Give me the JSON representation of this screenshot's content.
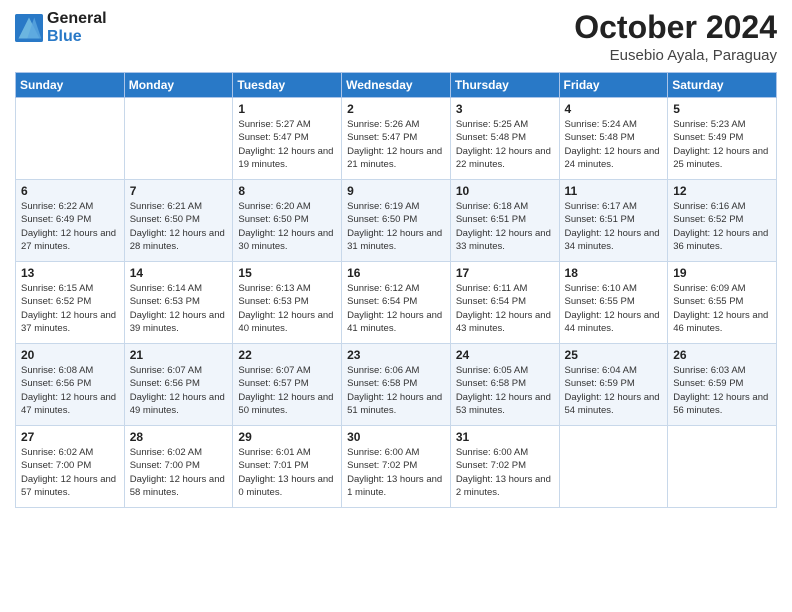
{
  "logo": {
    "line1": "General",
    "line2": "Blue"
  },
  "title": "October 2024",
  "location": "Eusebio Ayala, Paraguay",
  "days_of_week": [
    "Sunday",
    "Monday",
    "Tuesday",
    "Wednesday",
    "Thursday",
    "Friday",
    "Saturday"
  ],
  "weeks": [
    [
      {
        "day": "",
        "info": ""
      },
      {
        "day": "",
        "info": ""
      },
      {
        "day": "1",
        "info": "Sunrise: 5:27 AM\nSunset: 5:47 PM\nDaylight: 12 hours and 19 minutes."
      },
      {
        "day": "2",
        "info": "Sunrise: 5:26 AM\nSunset: 5:47 PM\nDaylight: 12 hours and 21 minutes."
      },
      {
        "day": "3",
        "info": "Sunrise: 5:25 AM\nSunset: 5:48 PM\nDaylight: 12 hours and 22 minutes."
      },
      {
        "day": "4",
        "info": "Sunrise: 5:24 AM\nSunset: 5:48 PM\nDaylight: 12 hours and 24 minutes."
      },
      {
        "day": "5",
        "info": "Sunrise: 5:23 AM\nSunset: 5:49 PM\nDaylight: 12 hours and 25 minutes."
      }
    ],
    [
      {
        "day": "6",
        "info": "Sunrise: 6:22 AM\nSunset: 6:49 PM\nDaylight: 12 hours and 27 minutes."
      },
      {
        "day": "7",
        "info": "Sunrise: 6:21 AM\nSunset: 6:50 PM\nDaylight: 12 hours and 28 minutes."
      },
      {
        "day": "8",
        "info": "Sunrise: 6:20 AM\nSunset: 6:50 PM\nDaylight: 12 hours and 30 minutes."
      },
      {
        "day": "9",
        "info": "Sunrise: 6:19 AM\nSunset: 6:50 PM\nDaylight: 12 hours and 31 minutes."
      },
      {
        "day": "10",
        "info": "Sunrise: 6:18 AM\nSunset: 6:51 PM\nDaylight: 12 hours and 33 minutes."
      },
      {
        "day": "11",
        "info": "Sunrise: 6:17 AM\nSunset: 6:51 PM\nDaylight: 12 hours and 34 minutes."
      },
      {
        "day": "12",
        "info": "Sunrise: 6:16 AM\nSunset: 6:52 PM\nDaylight: 12 hours and 36 minutes."
      }
    ],
    [
      {
        "day": "13",
        "info": "Sunrise: 6:15 AM\nSunset: 6:52 PM\nDaylight: 12 hours and 37 minutes."
      },
      {
        "day": "14",
        "info": "Sunrise: 6:14 AM\nSunset: 6:53 PM\nDaylight: 12 hours and 39 minutes."
      },
      {
        "day": "15",
        "info": "Sunrise: 6:13 AM\nSunset: 6:53 PM\nDaylight: 12 hours and 40 minutes."
      },
      {
        "day": "16",
        "info": "Sunrise: 6:12 AM\nSunset: 6:54 PM\nDaylight: 12 hours and 41 minutes."
      },
      {
        "day": "17",
        "info": "Sunrise: 6:11 AM\nSunset: 6:54 PM\nDaylight: 12 hours and 43 minutes."
      },
      {
        "day": "18",
        "info": "Sunrise: 6:10 AM\nSunset: 6:55 PM\nDaylight: 12 hours and 44 minutes."
      },
      {
        "day": "19",
        "info": "Sunrise: 6:09 AM\nSunset: 6:55 PM\nDaylight: 12 hours and 46 minutes."
      }
    ],
    [
      {
        "day": "20",
        "info": "Sunrise: 6:08 AM\nSunset: 6:56 PM\nDaylight: 12 hours and 47 minutes."
      },
      {
        "day": "21",
        "info": "Sunrise: 6:07 AM\nSunset: 6:56 PM\nDaylight: 12 hours and 49 minutes."
      },
      {
        "day": "22",
        "info": "Sunrise: 6:07 AM\nSunset: 6:57 PM\nDaylight: 12 hours and 50 minutes."
      },
      {
        "day": "23",
        "info": "Sunrise: 6:06 AM\nSunset: 6:58 PM\nDaylight: 12 hours and 51 minutes."
      },
      {
        "day": "24",
        "info": "Sunrise: 6:05 AM\nSunset: 6:58 PM\nDaylight: 12 hours and 53 minutes."
      },
      {
        "day": "25",
        "info": "Sunrise: 6:04 AM\nSunset: 6:59 PM\nDaylight: 12 hours and 54 minutes."
      },
      {
        "day": "26",
        "info": "Sunrise: 6:03 AM\nSunset: 6:59 PM\nDaylight: 12 hours and 56 minutes."
      }
    ],
    [
      {
        "day": "27",
        "info": "Sunrise: 6:02 AM\nSunset: 7:00 PM\nDaylight: 12 hours and 57 minutes."
      },
      {
        "day": "28",
        "info": "Sunrise: 6:02 AM\nSunset: 7:00 PM\nDaylight: 12 hours and 58 minutes."
      },
      {
        "day": "29",
        "info": "Sunrise: 6:01 AM\nSunset: 7:01 PM\nDaylight: 13 hours and 0 minutes."
      },
      {
        "day": "30",
        "info": "Sunrise: 6:00 AM\nSunset: 7:02 PM\nDaylight: 13 hours and 1 minute."
      },
      {
        "day": "31",
        "info": "Sunrise: 6:00 AM\nSunset: 7:02 PM\nDaylight: 13 hours and 2 minutes."
      },
      {
        "day": "",
        "info": ""
      },
      {
        "day": "",
        "info": ""
      }
    ]
  ]
}
